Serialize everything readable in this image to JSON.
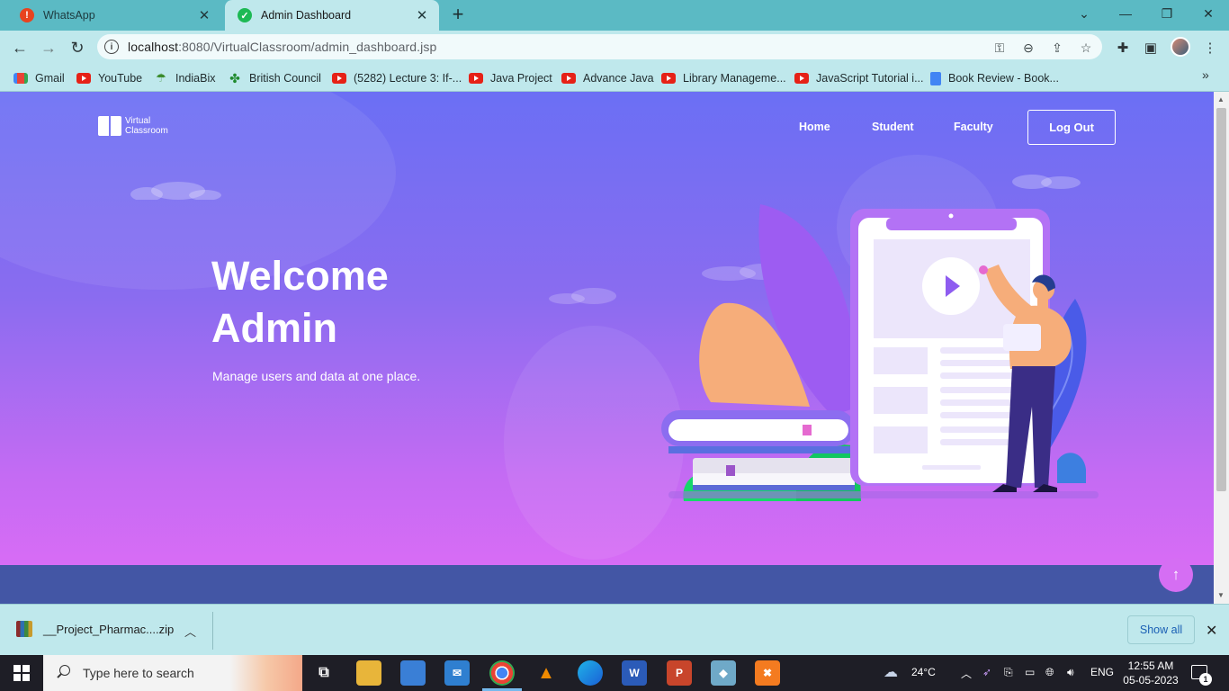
{
  "browser": {
    "tabs": [
      {
        "title": "WhatsApp",
        "favicon": "whatsapp-alert-icon",
        "favicon_color": "#e8431f",
        "active": false
      },
      {
        "title": "Admin Dashboard",
        "favicon": "check-circle-icon",
        "favicon_color": "#1db954",
        "active": true
      }
    ],
    "new_tab": "+",
    "url_host": "localhost",
    "url_rest": ":8080/VirtualClassroom/admin_dashboard.jsp",
    "bookmarks": [
      {
        "label": "Gmail",
        "icon": "gmail-icon"
      },
      {
        "label": "YouTube",
        "icon": "youtube-icon"
      },
      {
        "label": "IndiaBix",
        "icon": "indiabix-icon"
      },
      {
        "label": "British Council",
        "icon": "british-council-icon"
      },
      {
        "label": "(5282) Lecture 3: If-...",
        "icon": "youtube-icon"
      },
      {
        "label": "Java Project",
        "icon": "youtube-icon"
      },
      {
        "label": "Advance Java",
        "icon": "youtube-icon"
      },
      {
        "label": "Library Manageme...",
        "icon": "youtube-icon"
      },
      {
        "label": "JavaScript Tutorial i...",
        "icon": "youtube-icon"
      },
      {
        "label": "Book Review - Book...",
        "icon": "google-docs-icon"
      }
    ]
  },
  "site": {
    "logo_line1": "Virtual",
    "logo_line2": "Classroom",
    "nav": {
      "home": "Home",
      "student": "Student",
      "faculty": "Faculty",
      "logout": "Log Out"
    },
    "hero": {
      "title_line1": "Welcome",
      "title_line2": "Admin",
      "subtitle": "Manage users and data at one place."
    },
    "scroll_top_icon": "arrow-up-icon",
    "colors": {
      "gradient_top": "#6b6ff4",
      "gradient_bottom": "#e06cf6",
      "footer": "#4356a5"
    }
  },
  "downloads": {
    "file_name": "__Project_Pharmac....zip",
    "show_all": "Show all"
  },
  "taskbar": {
    "search_placeholder": "Type here to search",
    "weather": "24°C",
    "language": "ENG",
    "time": "12:55 AM",
    "date": "05-05-2023",
    "notification_count": "1"
  }
}
